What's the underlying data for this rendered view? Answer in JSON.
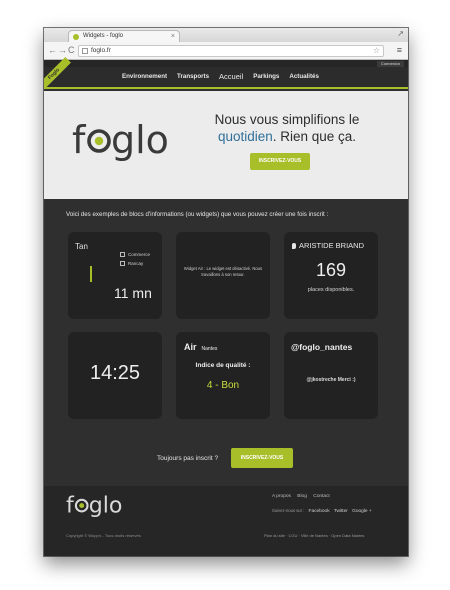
{
  "browser": {
    "tab_title": "Widgets - foglo",
    "tab_close": "×",
    "url": "foglo.fr",
    "back": "←",
    "forward": "→",
    "reload": "C",
    "star": "☆",
    "menu": "≡",
    "window_control": "↗"
  },
  "site": {
    "connexion": "Connexion",
    "ribbon": "Foglo",
    "nav": [
      "Environnement",
      "Transports",
      "Accueil",
      "Parkings",
      "Actualités"
    ],
    "logo_text": "foglo",
    "slogan_line1": "Nous vous simplifions le",
    "slogan_highlight": "quotidien",
    "slogan_rest": ". Rien que ça.",
    "cta_hero": "INSCRIVEZ-VOUS"
  },
  "main": {
    "intro": "Voici des exemples de blocs d'informations (ou widgets) que vous pouvez créer une fois inscrit :",
    "widgets": {
      "tan": {
        "name": "Tan",
        "stop1": "Commerce",
        "stop2": "Rancay",
        "time": "11 mn"
      },
      "air_disabled": {
        "message": "Widget Air : Le widget est désactivé. Nous travaillons à son retour."
      },
      "parking": {
        "name": "ARISTIDE BRIAND",
        "count": "169",
        "label": "places disponibles."
      },
      "clock": {
        "time": "14:25"
      },
      "air": {
        "title": "Air",
        "city": "Nantes",
        "quality_label": "Indice de qualité :",
        "quality_value": "4 - Bon"
      },
      "twitter": {
        "handle": "@foglo_nantes",
        "message": "@jkostreche Merci :)"
      }
    },
    "not_yet": "Toujours pas inscrit ?",
    "cta_bottom": "INSCRIVEZ-VOUS"
  },
  "footer": {
    "links": [
      "A propos",
      "Blog",
      "Contact"
    ],
    "follow_label": "Suivez-nous sur :",
    "social": [
      "Facebook",
      "Twitter",
      "Google +"
    ],
    "copyright": "Copyright © Wupp's - Tous droits réservés",
    "bottom_links": "Plan du site  ·  CGU  ·  Ville de Nantes  ·  Open Data Nantes"
  },
  "colors": {
    "accent": "#a8bf2a",
    "dark": "#2f2f2f",
    "link_blue": "#2f6f9a"
  }
}
